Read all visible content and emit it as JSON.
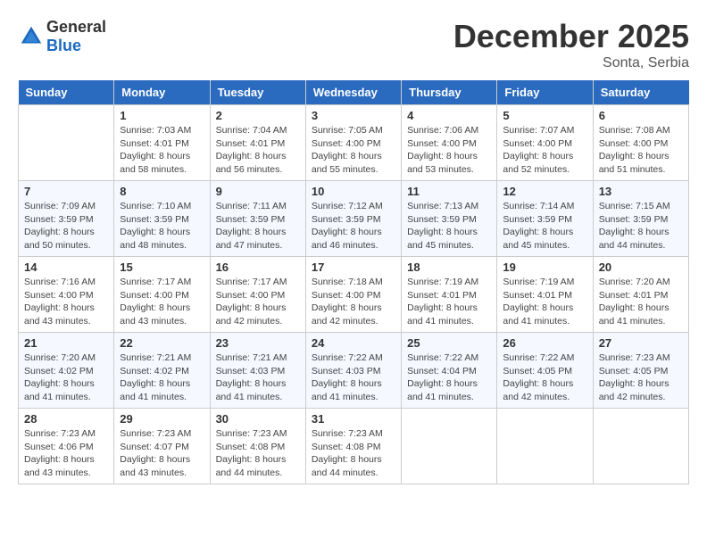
{
  "header": {
    "logo_general": "General",
    "logo_blue": "Blue",
    "month": "December 2025",
    "location": "Sonta, Serbia"
  },
  "days_of_week": [
    "Sunday",
    "Monday",
    "Tuesday",
    "Wednesday",
    "Thursday",
    "Friday",
    "Saturday"
  ],
  "weeks": [
    [
      {
        "day": "",
        "info": ""
      },
      {
        "day": "1",
        "info": "Sunrise: 7:03 AM\nSunset: 4:01 PM\nDaylight: 8 hours\nand 58 minutes."
      },
      {
        "day": "2",
        "info": "Sunrise: 7:04 AM\nSunset: 4:01 PM\nDaylight: 8 hours\nand 56 minutes."
      },
      {
        "day": "3",
        "info": "Sunrise: 7:05 AM\nSunset: 4:00 PM\nDaylight: 8 hours\nand 55 minutes."
      },
      {
        "day": "4",
        "info": "Sunrise: 7:06 AM\nSunset: 4:00 PM\nDaylight: 8 hours\nand 53 minutes."
      },
      {
        "day": "5",
        "info": "Sunrise: 7:07 AM\nSunset: 4:00 PM\nDaylight: 8 hours\nand 52 minutes."
      },
      {
        "day": "6",
        "info": "Sunrise: 7:08 AM\nSunset: 4:00 PM\nDaylight: 8 hours\nand 51 minutes."
      }
    ],
    [
      {
        "day": "7",
        "info": "Sunrise: 7:09 AM\nSunset: 3:59 PM\nDaylight: 8 hours\nand 50 minutes."
      },
      {
        "day": "8",
        "info": "Sunrise: 7:10 AM\nSunset: 3:59 PM\nDaylight: 8 hours\nand 48 minutes."
      },
      {
        "day": "9",
        "info": "Sunrise: 7:11 AM\nSunset: 3:59 PM\nDaylight: 8 hours\nand 47 minutes."
      },
      {
        "day": "10",
        "info": "Sunrise: 7:12 AM\nSunset: 3:59 PM\nDaylight: 8 hours\nand 46 minutes."
      },
      {
        "day": "11",
        "info": "Sunrise: 7:13 AM\nSunset: 3:59 PM\nDaylight: 8 hours\nand 45 minutes."
      },
      {
        "day": "12",
        "info": "Sunrise: 7:14 AM\nSunset: 3:59 PM\nDaylight: 8 hours\nand 45 minutes."
      },
      {
        "day": "13",
        "info": "Sunrise: 7:15 AM\nSunset: 3:59 PM\nDaylight: 8 hours\nand 44 minutes."
      }
    ],
    [
      {
        "day": "14",
        "info": "Sunrise: 7:16 AM\nSunset: 4:00 PM\nDaylight: 8 hours\nand 43 minutes."
      },
      {
        "day": "15",
        "info": "Sunrise: 7:17 AM\nSunset: 4:00 PM\nDaylight: 8 hours\nand 43 minutes."
      },
      {
        "day": "16",
        "info": "Sunrise: 7:17 AM\nSunset: 4:00 PM\nDaylight: 8 hours\nand 42 minutes."
      },
      {
        "day": "17",
        "info": "Sunrise: 7:18 AM\nSunset: 4:00 PM\nDaylight: 8 hours\nand 42 minutes."
      },
      {
        "day": "18",
        "info": "Sunrise: 7:19 AM\nSunset: 4:01 PM\nDaylight: 8 hours\nand 41 minutes."
      },
      {
        "day": "19",
        "info": "Sunrise: 7:19 AM\nSunset: 4:01 PM\nDaylight: 8 hours\nand 41 minutes."
      },
      {
        "day": "20",
        "info": "Sunrise: 7:20 AM\nSunset: 4:01 PM\nDaylight: 8 hours\nand 41 minutes."
      }
    ],
    [
      {
        "day": "21",
        "info": "Sunrise: 7:20 AM\nSunset: 4:02 PM\nDaylight: 8 hours\nand 41 minutes."
      },
      {
        "day": "22",
        "info": "Sunrise: 7:21 AM\nSunset: 4:02 PM\nDaylight: 8 hours\nand 41 minutes."
      },
      {
        "day": "23",
        "info": "Sunrise: 7:21 AM\nSunset: 4:03 PM\nDaylight: 8 hours\nand 41 minutes."
      },
      {
        "day": "24",
        "info": "Sunrise: 7:22 AM\nSunset: 4:03 PM\nDaylight: 8 hours\nand 41 minutes."
      },
      {
        "day": "25",
        "info": "Sunrise: 7:22 AM\nSunset: 4:04 PM\nDaylight: 8 hours\nand 41 minutes."
      },
      {
        "day": "26",
        "info": "Sunrise: 7:22 AM\nSunset: 4:05 PM\nDaylight: 8 hours\nand 42 minutes."
      },
      {
        "day": "27",
        "info": "Sunrise: 7:23 AM\nSunset: 4:05 PM\nDaylight: 8 hours\nand 42 minutes."
      }
    ],
    [
      {
        "day": "28",
        "info": "Sunrise: 7:23 AM\nSunset: 4:06 PM\nDaylight: 8 hours\nand 43 minutes."
      },
      {
        "day": "29",
        "info": "Sunrise: 7:23 AM\nSunset: 4:07 PM\nDaylight: 8 hours\nand 43 minutes."
      },
      {
        "day": "30",
        "info": "Sunrise: 7:23 AM\nSunset: 4:08 PM\nDaylight: 8 hours\nand 44 minutes."
      },
      {
        "day": "31",
        "info": "Sunrise: 7:23 AM\nSunset: 4:08 PM\nDaylight: 8 hours\nand 44 minutes."
      },
      {
        "day": "",
        "info": ""
      },
      {
        "day": "",
        "info": ""
      },
      {
        "day": "",
        "info": ""
      }
    ]
  ]
}
